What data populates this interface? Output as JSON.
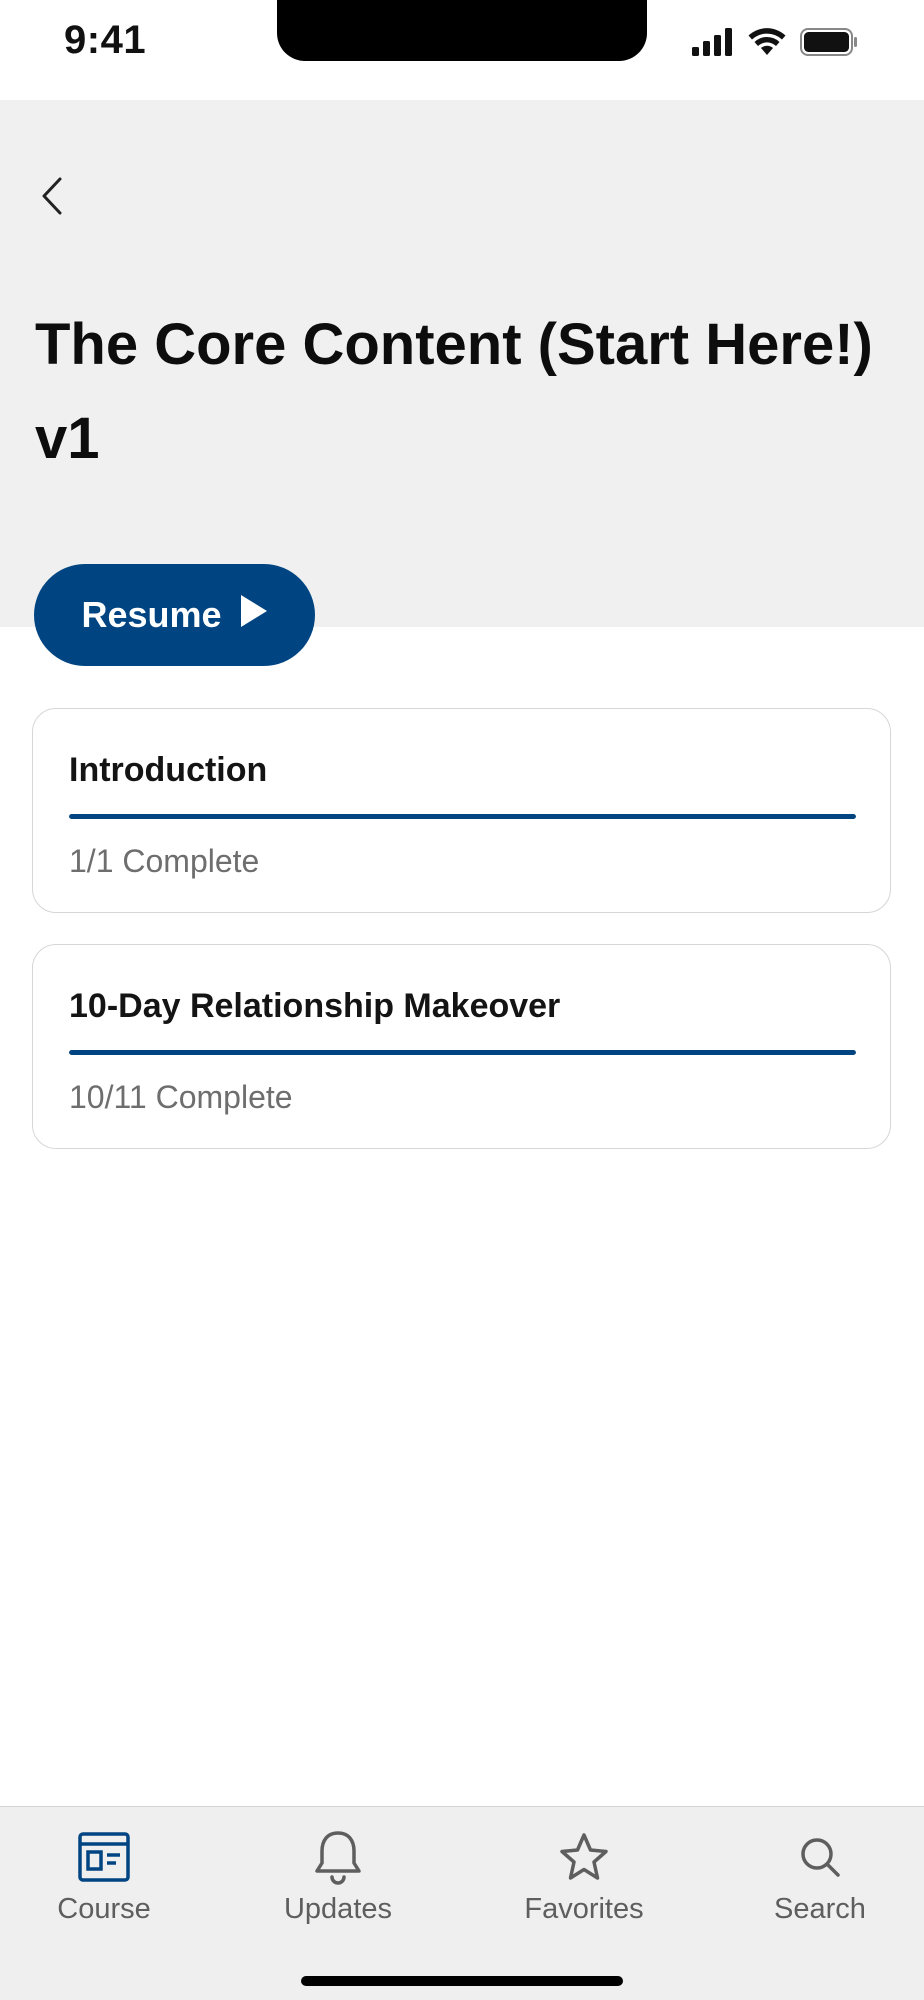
{
  "status_bar": {
    "time": "9:41"
  },
  "header": {
    "back_icon": "chevron-left-icon",
    "title": "The Core Content (Start Here!) v1"
  },
  "resume_button": {
    "label": "Resume",
    "icon": "play-icon"
  },
  "sections": [
    {
      "title": "Introduction",
      "status": "1/1 Complete",
      "progress": 1.0
    },
    {
      "title": "10-Day Relationship Makeover",
      "status": "10/11 Complete",
      "progress": 1.0
    }
  ],
  "tab_bar": {
    "tabs": [
      {
        "label": "Course",
        "icon": "course-icon",
        "active": true
      },
      {
        "label": "Updates",
        "icon": "bell-icon",
        "active": false
      },
      {
        "label": "Favorites",
        "icon": "star-icon",
        "active": false
      },
      {
        "label": "Search",
        "icon": "search-icon",
        "active": false
      }
    ]
  },
  "colors": {
    "accent": "#004582",
    "header_bg": "#f0f0f0",
    "tab_bar_bg": "#efefef",
    "muted_text": "#6e6e6e"
  }
}
